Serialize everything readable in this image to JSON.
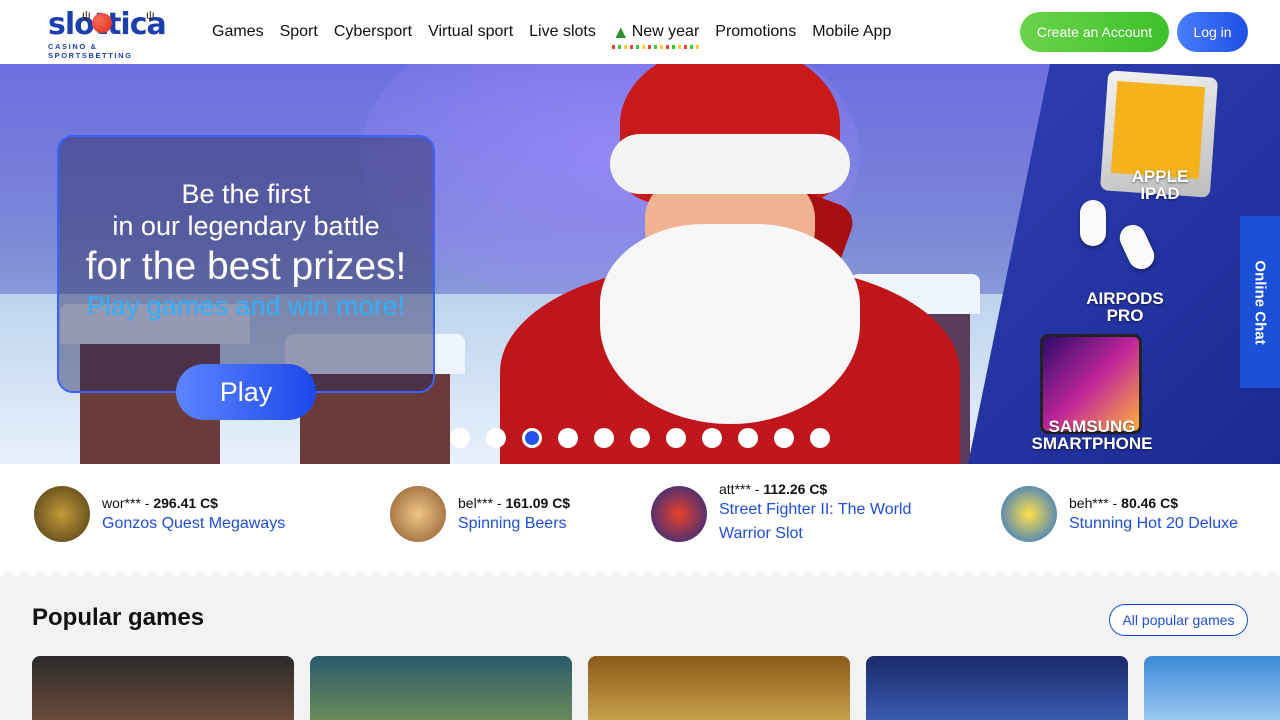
{
  "header": {
    "logo_main": "slottica",
    "logo_sub": "CASINO & SPORTSBETTING",
    "nav": [
      "Games",
      "Sport",
      "Cybersport",
      "Virtual sport",
      "Live slots",
      "New year",
      "Promotions",
      "Mobile App"
    ],
    "create_account": "Create an Account",
    "login": "Log in"
  },
  "hero": {
    "line1": "Be the first",
    "line2": "in our legendary battle",
    "line3": "for the best prizes!",
    "line4": "Play games and win more!",
    "play": "Play",
    "prizes": [
      "APPLE IPAD",
      "AIRPODS PRO",
      "SAMSUNG SMARTPHONE"
    ],
    "slides_total": 11,
    "active_slide": 3
  },
  "chat": {
    "label": "Online Chat"
  },
  "winners": [
    {
      "user": "wor***",
      "amount": "296.41 C$",
      "game": "Gonzos Quest Megaways"
    },
    {
      "user": "bel***",
      "amount": "161.09 C$",
      "game": "Spinning Beers"
    },
    {
      "user": "att***",
      "amount": "112.26 C$",
      "game": "Street Fighter II: The World Warrior Slot"
    },
    {
      "user": "beh***",
      "amount": "80.46 C$",
      "game": "Stunning Hot 20 Deluxe"
    }
  ],
  "popular": {
    "title": "Popular games",
    "all_button": "All popular games"
  },
  "colors": {
    "brand_blue": "#1f4fd8",
    "create_green": "#3cc22a",
    "chat_blue": "#1c4fd8"
  }
}
